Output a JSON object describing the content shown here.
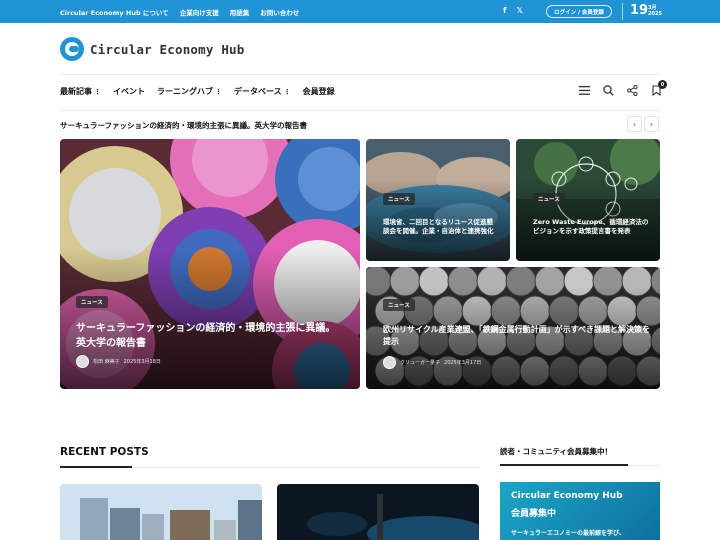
{
  "topbar": {
    "links": [
      "Circular Economy Hub について",
      "企業向け支援",
      "用語集",
      "お問い合わせ"
    ],
    "social": [
      "f",
      "𝕏"
    ],
    "login": "ログイン / 会員登録",
    "date_day": "19",
    "date_month": "3月",
    "date_year": "2025"
  },
  "logo": {
    "text": "Circular Economy Hub"
  },
  "nav": {
    "items": [
      {
        "label": "最新記事",
        "has_menu": true
      },
      {
        "label": "イベント",
        "has_menu": false
      },
      {
        "label": "ラーニングハブ",
        "has_menu": true
      },
      {
        "label": "データベース",
        "has_menu": true
      },
      {
        "label": "会員登録",
        "has_menu": false
      }
    ],
    "caret": "⋮",
    "bookmark_count": "0"
  },
  "ticker": {
    "text": "サーキュラーファッションの経済的・環境的主張に異議。英大学の報告書",
    "prev": "‹",
    "next": "›"
  },
  "cards": [
    {
      "tag": "ニュース",
      "title": "サーキュラーファッションの経済的・環境的主張に異議。英大学の報告書",
      "author": "松田 麻美子",
      "date": "2025年3月18日"
    },
    {
      "tag": "ニュース",
      "title": "環境省、二回目となるリユース促進懇談会を開催。企業・自治体と連携強化"
    },
    {
      "tag": "ニュース",
      "title": "Zero Waste Europe、循環経済法のビジョンを示す政策提言書を発表"
    },
    {
      "tag": "ニュース",
      "title": "欧州リサイクル産業連盟、「鉄鋼金属行動計画」が示すべき課題と解決策を提示",
      "author": "クリューガー量子",
      "date": "2025年3月17日"
    }
  ],
  "recent": {
    "heading": "RECENT POSTS"
  },
  "sidebar": {
    "heading": "読者・コミュニティ会員募集中！",
    "promo_line1": "Circular Economy Hub",
    "promo_line2": "会員募集中",
    "promo_line3": "サーキュラーエコノミーの最前線を学び、"
  },
  "colors": {
    "brand": "#1f93d3",
    "text": "#111111"
  }
}
